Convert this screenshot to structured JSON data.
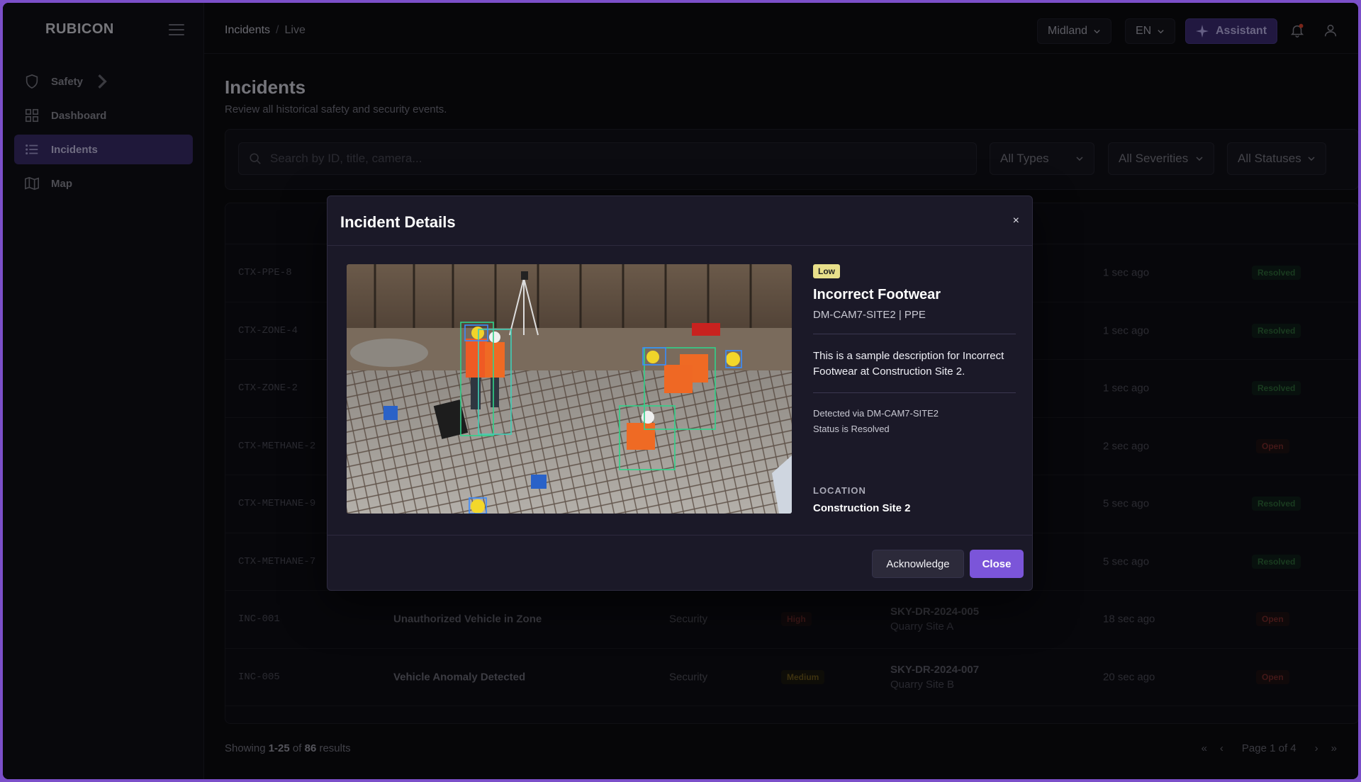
{
  "app": {
    "brand": "RUBICON"
  },
  "sidebar": {
    "items": [
      {
        "label": "Safety",
        "icon": "shield-icon"
      },
      {
        "label": "Dashboard",
        "icon": "grid-icon"
      },
      {
        "label": "Incidents",
        "icon": "list-icon",
        "active": true
      },
      {
        "label": "Map",
        "icon": "map-icon"
      }
    ]
  },
  "topbar": {
    "breadcrumb": {
      "root": "Incidents",
      "current": "Live"
    },
    "region": "Midland",
    "language": "EN",
    "assistant_label": "Assistant"
  },
  "page": {
    "title": "Incidents",
    "subtitle": "Review all historical safety and security events."
  },
  "filters": {
    "search_placeholder": "Search by ID, title, camera...",
    "type": "All Types",
    "severity": "All Severities",
    "status": "All Statuses"
  },
  "table": {
    "rows": [
      {
        "id": "CTX-PPE-8",
        "time": "1 sec ago",
        "status": "Resolved"
      },
      {
        "id": "CTX-ZONE-4",
        "time": "1 sec ago",
        "status": "Resolved"
      },
      {
        "id": "CTX-ZONE-2",
        "time": "1 sec ago",
        "status": "Resolved"
      },
      {
        "id": "CTX-METHANE-2",
        "time": "2 sec ago",
        "status": "Open"
      },
      {
        "id": "CTX-METHANE-9",
        "time": "5 sec ago",
        "status": "Resolved"
      },
      {
        "id": "CTX-METHANE-7",
        "time": "5 sec ago",
        "status": "Resolved"
      },
      {
        "id": "INC-001",
        "title": "Unauthorized Vehicle in Zone",
        "type": "Security",
        "severity": "High",
        "source": "SKY-DR-2024-005",
        "site": "Quarry Site A",
        "time": "18 sec ago",
        "status": "Open"
      },
      {
        "id": "INC-005",
        "title": "Vehicle Anomaly Detected",
        "type": "Security",
        "severity": "Medium",
        "source": "SKY-DR-2024-007",
        "site": "Quarry Site B",
        "time": "20 sec ago",
        "status": "Open"
      }
    ]
  },
  "footer": {
    "showing_prefix": "Showing",
    "range": "1-25",
    "of": "of",
    "total": "86",
    "results": "results",
    "page_label": "Page 1 of 4"
  },
  "modal": {
    "title": "Incident Details",
    "close_x": "×",
    "severity": "Low",
    "incident_title": "Incorrect Footwear",
    "subtitle": "DM-CAM7-SITE2 | PPE",
    "description": "This is a sample description for Incorrect Footwear at Construction Site 2.",
    "detected_via": "Detected via DM-CAM7-SITE2",
    "status_line": "Status is Resolved",
    "location_label": "LOCATION",
    "location_value": "Construction Site 2",
    "acknowledge_label": "Acknowledge",
    "close_label": "Close"
  },
  "colors": {
    "accent": "#7b55d9",
    "frame": "#7b4fc9",
    "low_badge": "#e8df8a"
  }
}
